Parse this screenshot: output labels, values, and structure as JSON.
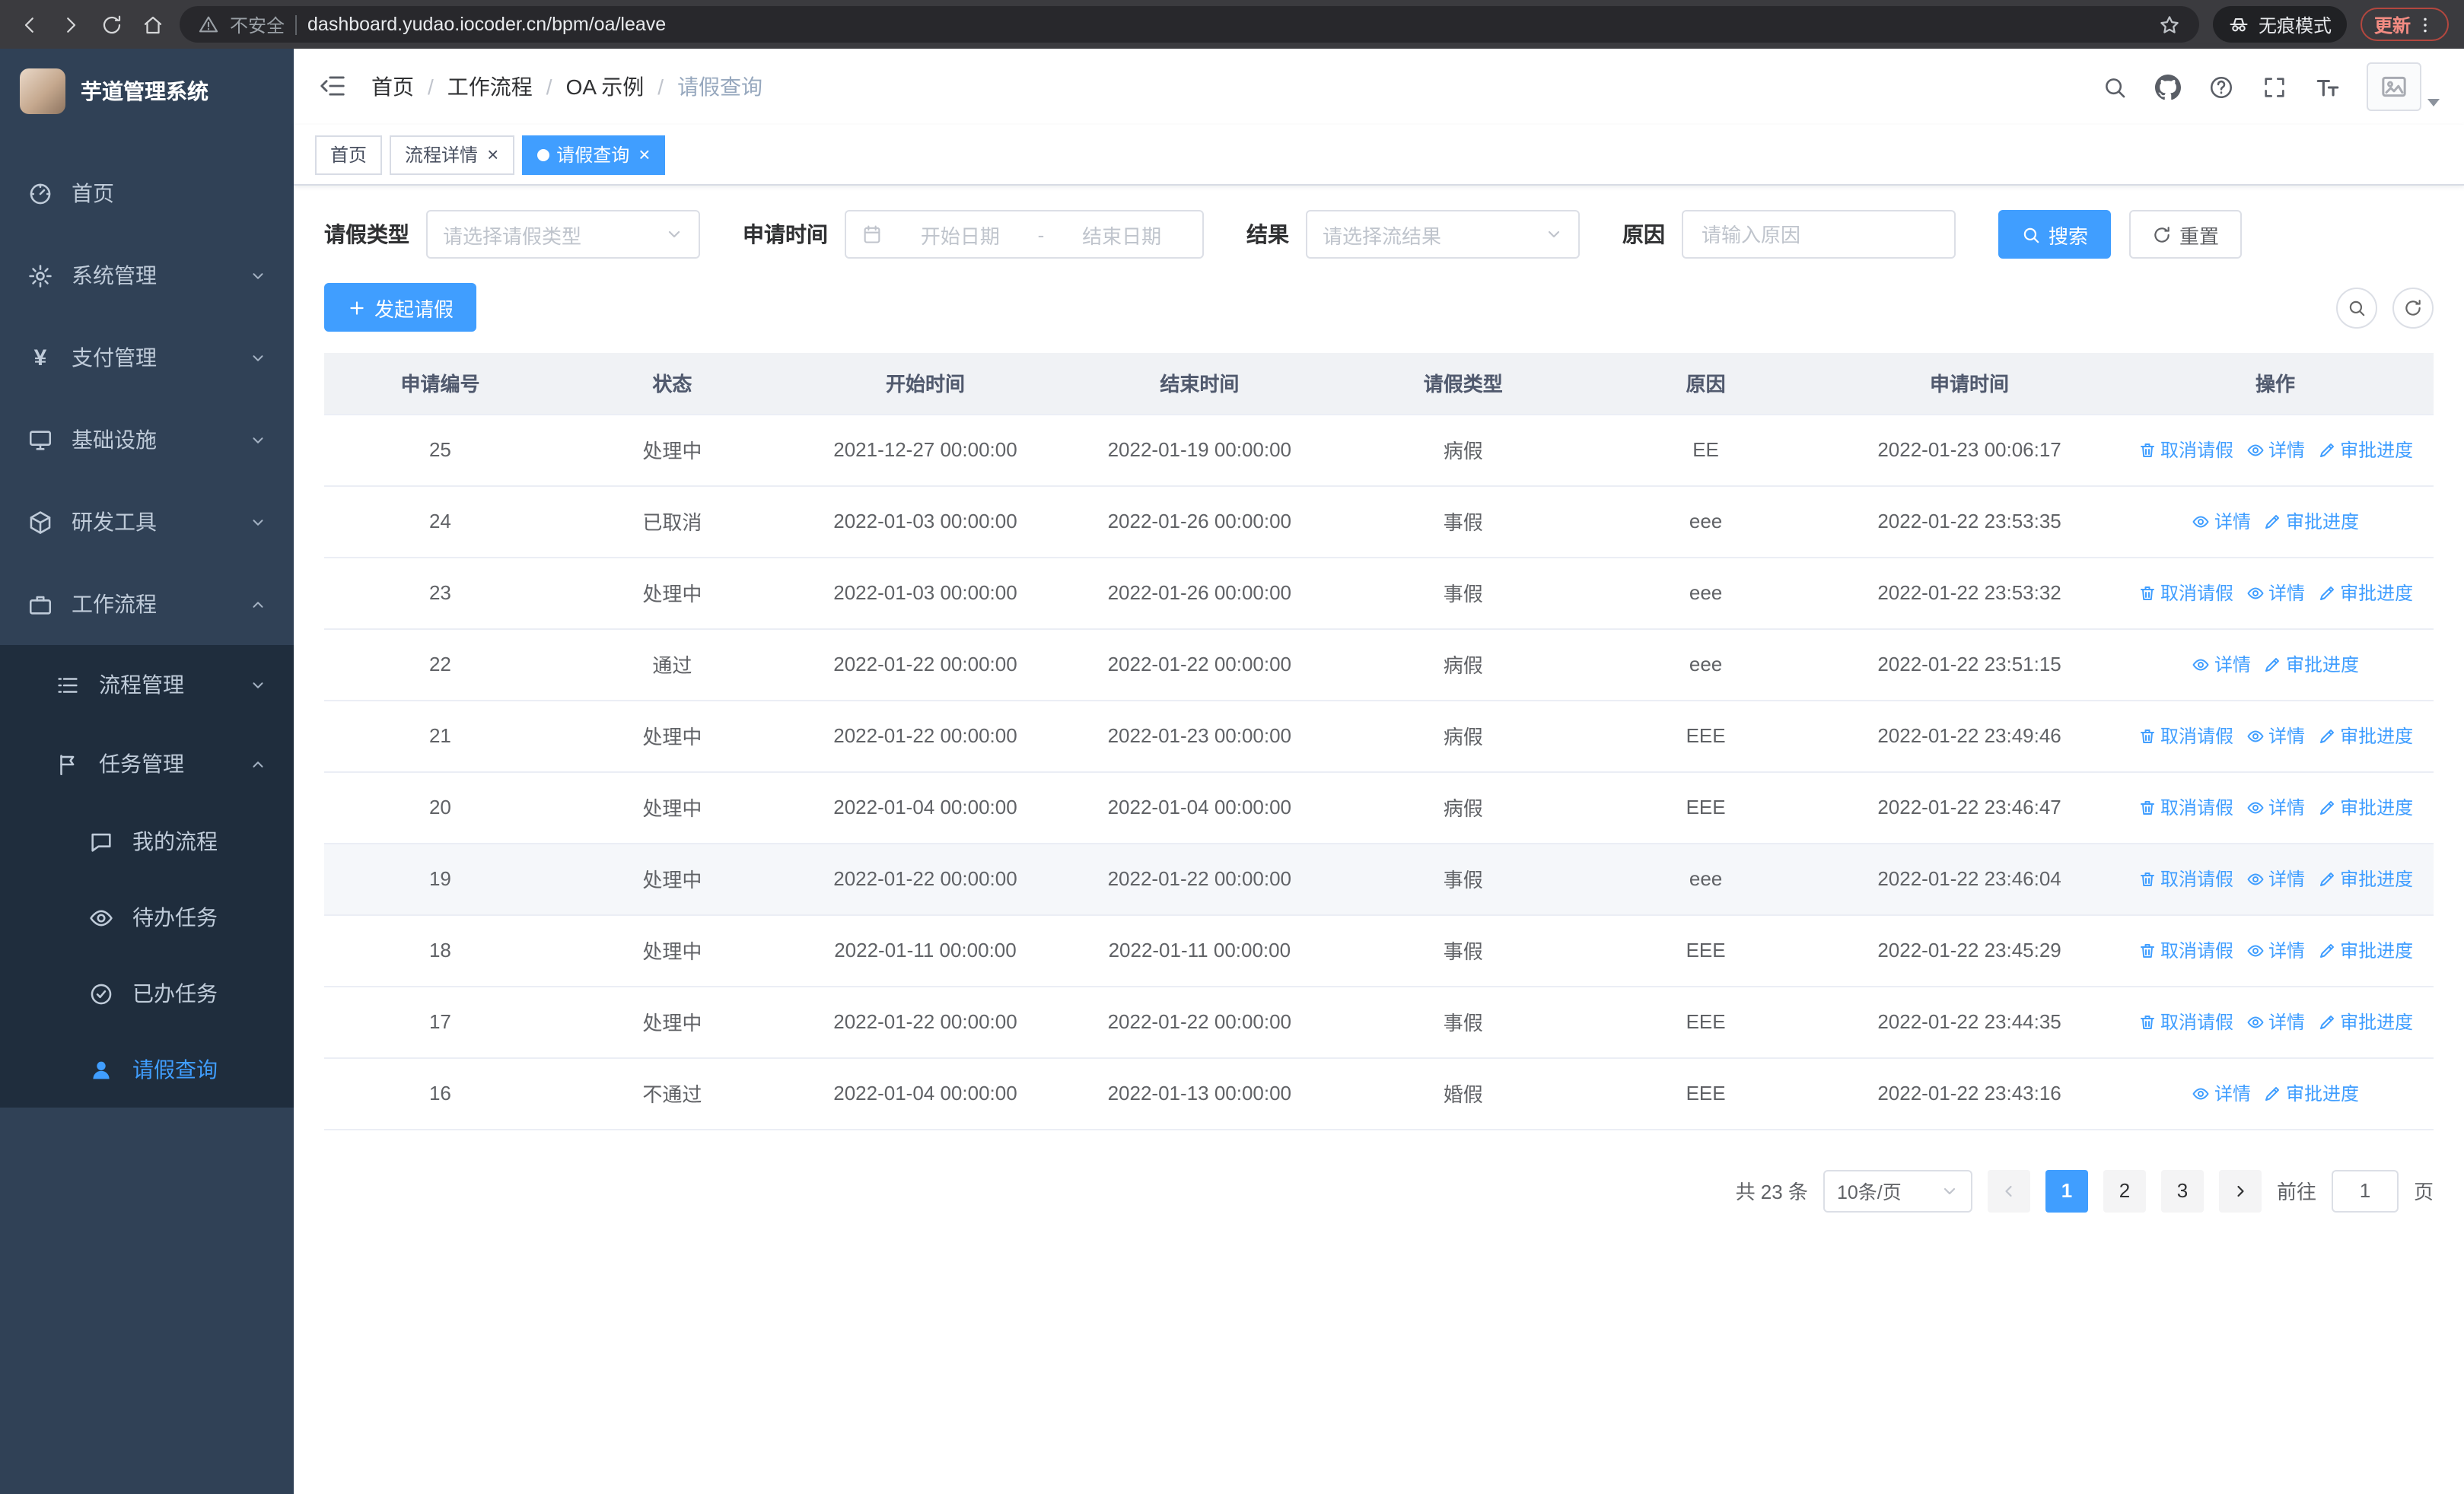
{
  "colors": {
    "accent": "#409eff",
    "sidebar_bg": "#304156",
    "sidebar_submenu_bg": "#1f2d3d",
    "table_header_bg": "#f0f2f5"
  },
  "browser": {
    "security_label": "不安全",
    "url": "dashboard.yudao.iocoder.cn/bpm/oa/leave",
    "incognito_label": "无痕模式",
    "update_label": "更新"
  },
  "sidebar": {
    "title": "芋道管理系统",
    "items": [
      {
        "label": "首页",
        "icon": "dashboard-icon"
      },
      {
        "label": "系统管理",
        "icon": "gear-icon"
      },
      {
        "label": "支付管理",
        "icon": "yen-icon"
      },
      {
        "label": "基础设施",
        "icon": "monitor-icon"
      },
      {
        "label": "研发工具",
        "icon": "cube-icon"
      },
      {
        "label": "工作流程",
        "icon": "briefcase-icon"
      }
    ],
    "workflow_submenu": [
      {
        "label": "流程管理",
        "icon": "list-icon"
      },
      {
        "label": "任务管理",
        "icon": "flag-icon"
      }
    ],
    "task_children": [
      {
        "label": "我的流程",
        "icon": "chat-icon"
      },
      {
        "label": "待办任务",
        "icon": "eye-icon"
      },
      {
        "label": "已办任务",
        "icon": "check-circle-icon"
      },
      {
        "label": "请假查询",
        "icon": "user-icon"
      }
    ]
  },
  "header": {
    "breadcrumb": [
      "首页",
      "工作流程",
      "OA 示例",
      "请假查询"
    ]
  },
  "tabs": [
    {
      "label": "首页"
    },
    {
      "label": "流程详情"
    },
    {
      "label": "请假查询"
    }
  ],
  "filters": {
    "leave_type_label": "请假类型",
    "leave_type_placeholder": "请选择请假类型",
    "apply_time_label": "申请时间",
    "start_date_placeholder": "开始日期",
    "date_separator": "-",
    "end_date_placeholder": "结束日期",
    "result_label": "结果",
    "result_placeholder": "请选择流结果",
    "reason_label": "原因",
    "reason_placeholder": "请输入原因",
    "search_label": "搜索",
    "reset_label": "重置"
  },
  "toolbar": {
    "create_label": "发起请假"
  },
  "actions": {
    "cancel": "取消请假",
    "detail": "详情",
    "progress": "审批进度"
  },
  "table": {
    "headers": [
      "申请编号",
      "状态",
      "开始时间",
      "结束时间",
      "请假类型",
      "原因",
      "申请时间",
      "操作"
    ],
    "rows": [
      {
        "id": "25",
        "status": "处理中",
        "start": "2021-12-27 00:00:00",
        "end": "2022-01-19 00:00:00",
        "type": "病假",
        "reason": "EE",
        "apply_time": "2022-01-23 00:06:17",
        "actions": [
          "cancel",
          "detail",
          "progress"
        ]
      },
      {
        "id": "24",
        "status": "已取消",
        "start": "2022-01-03 00:00:00",
        "end": "2022-01-26 00:00:00",
        "type": "事假",
        "reason": "eee",
        "apply_time": "2022-01-22 23:53:35",
        "actions": [
          "detail",
          "progress"
        ]
      },
      {
        "id": "23",
        "status": "处理中",
        "start": "2022-01-03 00:00:00",
        "end": "2022-01-26 00:00:00",
        "type": "事假",
        "reason": "eee",
        "apply_time": "2022-01-22 23:53:32",
        "actions": [
          "cancel",
          "detail",
          "progress"
        ]
      },
      {
        "id": "22",
        "status": "通过",
        "start": "2022-01-22 00:00:00",
        "end": "2022-01-22 00:00:00",
        "type": "病假",
        "reason": "eee",
        "apply_time": "2022-01-22 23:51:15",
        "actions": [
          "detail",
          "progress"
        ]
      },
      {
        "id": "21",
        "status": "处理中",
        "start": "2022-01-22 00:00:00",
        "end": "2022-01-23 00:00:00",
        "type": "病假",
        "reason": "EEE",
        "apply_time": "2022-01-22 23:49:46",
        "actions": [
          "cancel",
          "detail",
          "progress"
        ]
      },
      {
        "id": "20",
        "status": "处理中",
        "start": "2022-01-04 00:00:00",
        "end": "2022-01-04 00:00:00",
        "type": "病假",
        "reason": "EEE",
        "apply_time": "2022-01-22 23:46:47",
        "actions": [
          "cancel",
          "detail",
          "progress"
        ]
      },
      {
        "id": "19",
        "status": "处理中",
        "start": "2022-01-22 00:00:00",
        "end": "2022-01-22 00:00:00",
        "type": "事假",
        "reason": "eee",
        "apply_time": "2022-01-22 23:46:04",
        "actions": [
          "cancel",
          "detail",
          "progress"
        ],
        "highlighted": true
      },
      {
        "id": "18",
        "status": "处理中",
        "start": "2022-01-11 00:00:00",
        "end": "2022-01-11 00:00:00",
        "type": "事假",
        "reason": "EEE",
        "apply_time": "2022-01-22 23:45:29",
        "actions": [
          "cancel",
          "detail",
          "progress"
        ]
      },
      {
        "id": "17",
        "status": "处理中",
        "start": "2022-01-22 00:00:00",
        "end": "2022-01-22 00:00:00",
        "type": "事假",
        "reason": "EEE",
        "apply_time": "2022-01-22 23:44:35",
        "actions": [
          "cancel",
          "detail",
          "progress"
        ]
      },
      {
        "id": "16",
        "status": "不通过",
        "start": "2022-01-04 00:00:00",
        "end": "2022-01-13 00:00:00",
        "type": "婚假",
        "reason": "EEE",
        "apply_time": "2022-01-22 23:43:16",
        "actions": [
          "detail",
          "progress"
        ]
      }
    ]
  },
  "pagination": {
    "total_text": "共 23 条",
    "page_size": "10条/页",
    "pages": [
      "1",
      "2",
      "3"
    ],
    "active_page": "1",
    "goto_label": "前往",
    "goto_value": "1",
    "page_suffix": "页"
  }
}
